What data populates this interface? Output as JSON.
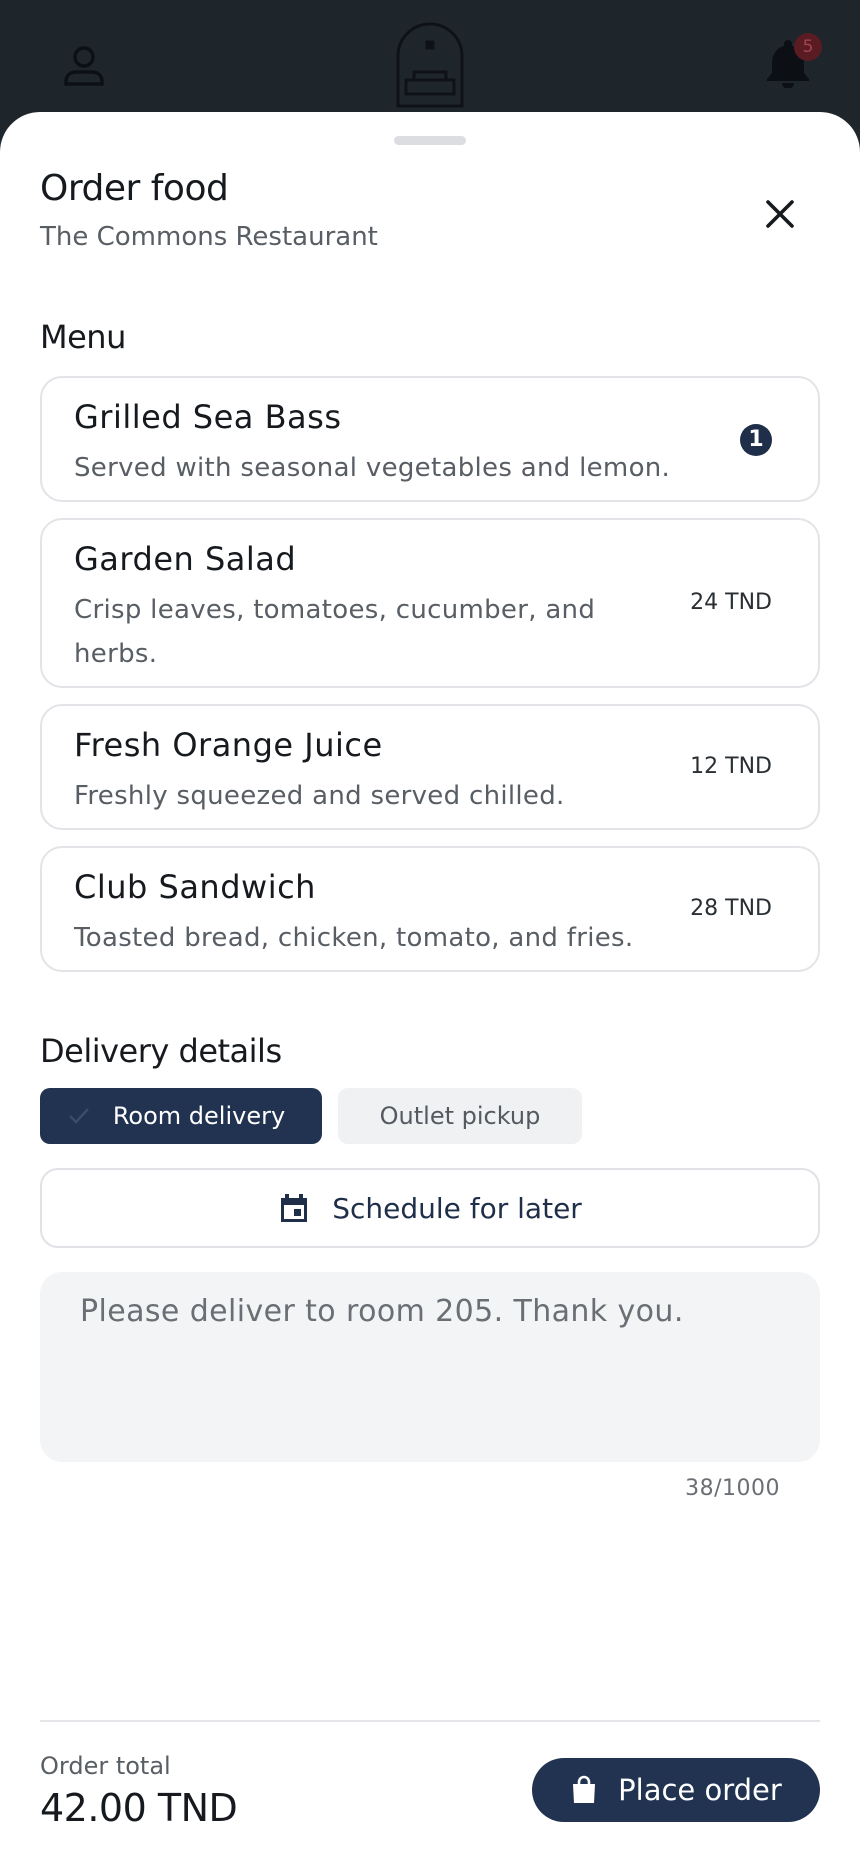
{
  "header": {
    "notification_count": "5"
  },
  "sheet": {
    "title": "Order food",
    "subtitle": "The Commons Restaurant"
  },
  "menu": {
    "label": "Menu",
    "items": [
      {
        "name": "Grilled Sea Bass",
        "description": "Served with seasonal vegetables and lemon.",
        "quantity": "1"
      },
      {
        "name": "Garden Salad",
        "description": "Crisp leaves, tomatoes, cucumber, and herbs.",
        "price": "24 TND"
      },
      {
        "name": "Fresh Orange Juice",
        "description": "Freshly squeezed and served chilled.",
        "price": "12 TND"
      },
      {
        "name": "Club Sandwich",
        "description": "Toasted bread, chicken, tomato, and fries.",
        "price": "28 TND"
      }
    ]
  },
  "delivery": {
    "label": "Delivery details",
    "option_room": "Room delivery",
    "option_pickup": "Outlet pickup",
    "schedule_label": "Schedule for later",
    "notes_value": "Please deliver to room 205. Thank you.",
    "notes_counter": "38/1000"
  },
  "footer": {
    "total_label": "Order total",
    "total_value": "42.00 TND",
    "place_order_label": "Place order"
  },
  "colors": {
    "primary": "#213351",
    "header_bg": "#1e262c",
    "text": "#161a1e",
    "muted": "#585e64"
  }
}
